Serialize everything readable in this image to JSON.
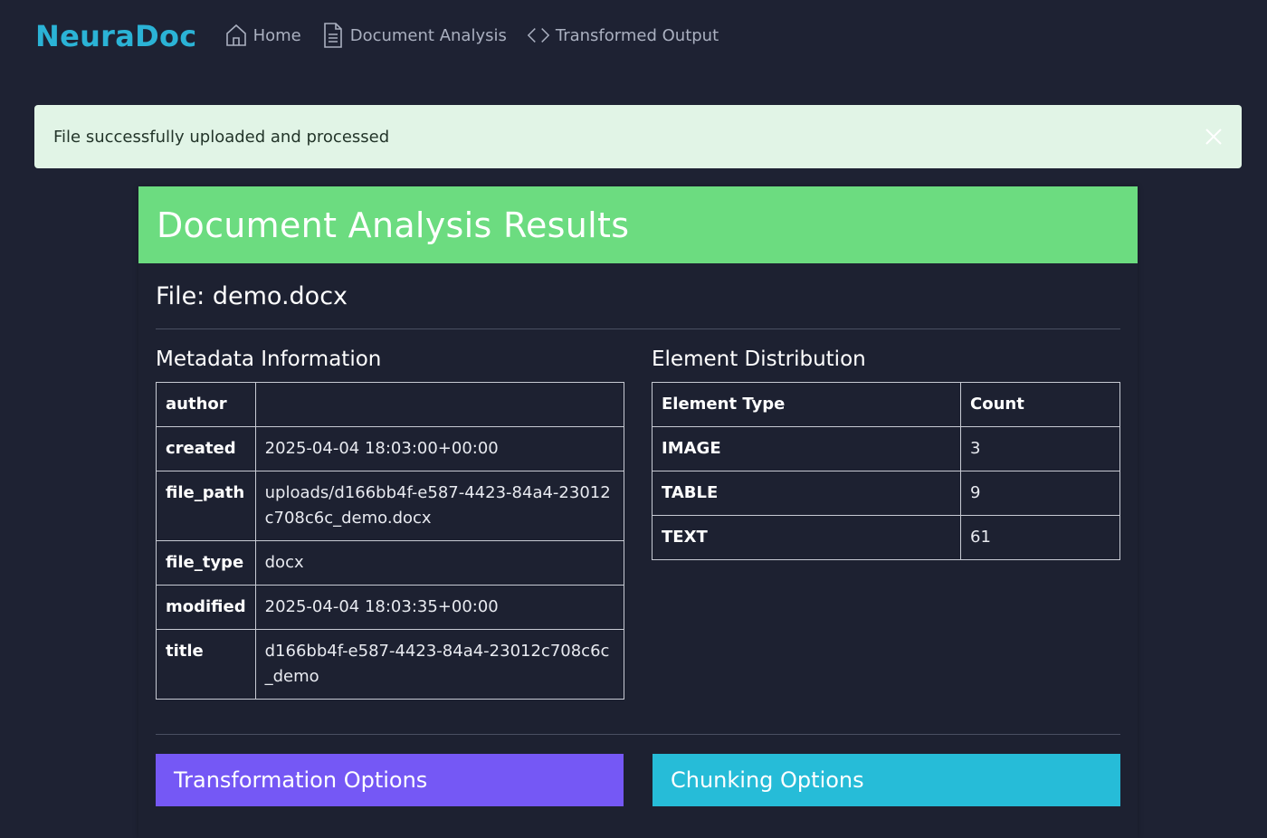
{
  "navbar": {
    "brand": "NeuraDoc",
    "links": [
      {
        "label": "Home",
        "icon": "home-icon"
      },
      {
        "label": "Document Analysis",
        "icon": "document-icon"
      },
      {
        "label": "Transformed Output",
        "icon": "code-icon"
      }
    ]
  },
  "alert": {
    "message": "File successfully uploaded and processed"
  },
  "card": {
    "title": "Document Analysis Results",
    "file_heading": "File: demo.docx",
    "metadata": {
      "title": "Metadata Information",
      "rows": [
        {
          "key": "author",
          "value": ""
        },
        {
          "key": "created",
          "value": "2025-04-04 18:03:00+00:00"
        },
        {
          "key": "file_path",
          "value": "uploads/d166bb4f-e587-4423-84a4-23012c708c6c_demo.docx"
        },
        {
          "key": "file_type",
          "value": "docx"
        },
        {
          "key": "modified",
          "value": "2025-04-04 18:03:35+00:00"
        },
        {
          "key": "title",
          "value": "d166bb4f-e587-4423-84a4-23012c708c6c_demo"
        }
      ]
    },
    "distribution": {
      "title": "Element Distribution",
      "headers": [
        "Element Type",
        "Count"
      ],
      "rows": [
        {
          "type": "IMAGE",
          "count": "3"
        },
        {
          "type": "TABLE",
          "count": "9"
        },
        {
          "type": "TEXT",
          "count": "61"
        }
      ]
    },
    "options": {
      "transformation": "Transformation Options",
      "chunking": "Chunking Options"
    }
  },
  "colors": {
    "background": "#1e2233",
    "brand": "#2bb3d6",
    "header_green": "#6cdc80",
    "alert_bg": "#e1f4e6",
    "transform_purple": "#7558f5",
    "chunk_cyan": "#26bcd8"
  }
}
